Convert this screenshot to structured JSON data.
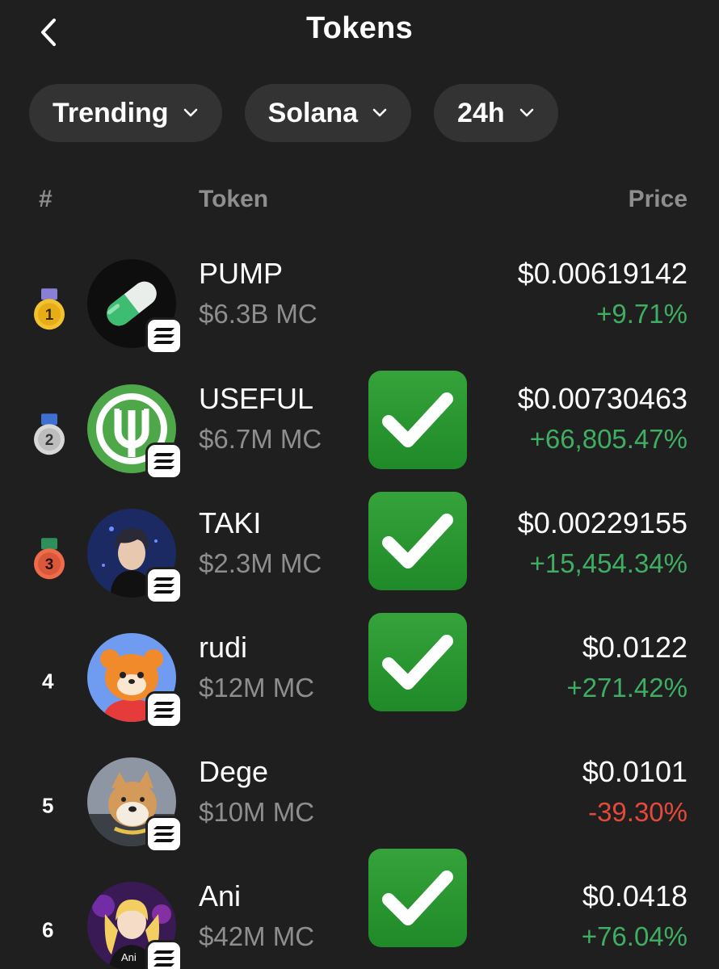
{
  "header": {
    "title": "Tokens"
  },
  "filters": [
    {
      "label": "Trending"
    },
    {
      "label": "Solana"
    },
    {
      "label": "24h"
    }
  ],
  "columns": {
    "rank": "#",
    "token": "Token",
    "price": "Price"
  },
  "tokens": [
    {
      "rank": "1",
      "name": "PUMP",
      "mc": "$6.3B MC",
      "price": "$0.00619142",
      "change": "+9.71%",
      "direction": "up",
      "checked": false,
      "medal": "gold"
    },
    {
      "rank": "2",
      "name": "USEFUL",
      "mc": "$6.7M MC",
      "price": "$0.00730463",
      "change": "+66,805.47%",
      "direction": "up",
      "checked": true,
      "medal": "silver"
    },
    {
      "rank": "3",
      "name": "TAKI",
      "mc": "$2.3M MC",
      "price": "$0.00229155",
      "change": "+15,454.34%",
      "direction": "up",
      "checked": true,
      "medal": "bronze"
    },
    {
      "rank": "4",
      "name": "rudi",
      "mc": "$12M MC",
      "price": "$0.0122",
      "change": "+271.42%",
      "direction": "up",
      "checked": true
    },
    {
      "rank": "5",
      "name": "Dege",
      "mc": "$10M MC",
      "price": "$0.0101",
      "change": "-39.30%",
      "direction": "down",
      "checked": false
    },
    {
      "rank": "6",
      "name": "Ani",
      "mc": "$42M MC",
      "price": "$0.0418",
      "change": "+76.04%",
      "direction": "up",
      "checked": true,
      "avatar_caption": "Ani"
    }
  ],
  "colors": {
    "background": "#1f1f1f",
    "chip": "#333333",
    "up": "#3fae63",
    "down": "#e5493a",
    "muted": "#8e8e8e",
    "check": "#2a9a31"
  },
  "icons": {
    "back": "chevron-left-icon",
    "dropdown": "chevron-down-icon",
    "chain": "solana-icon",
    "check": "check-mark-icon"
  }
}
